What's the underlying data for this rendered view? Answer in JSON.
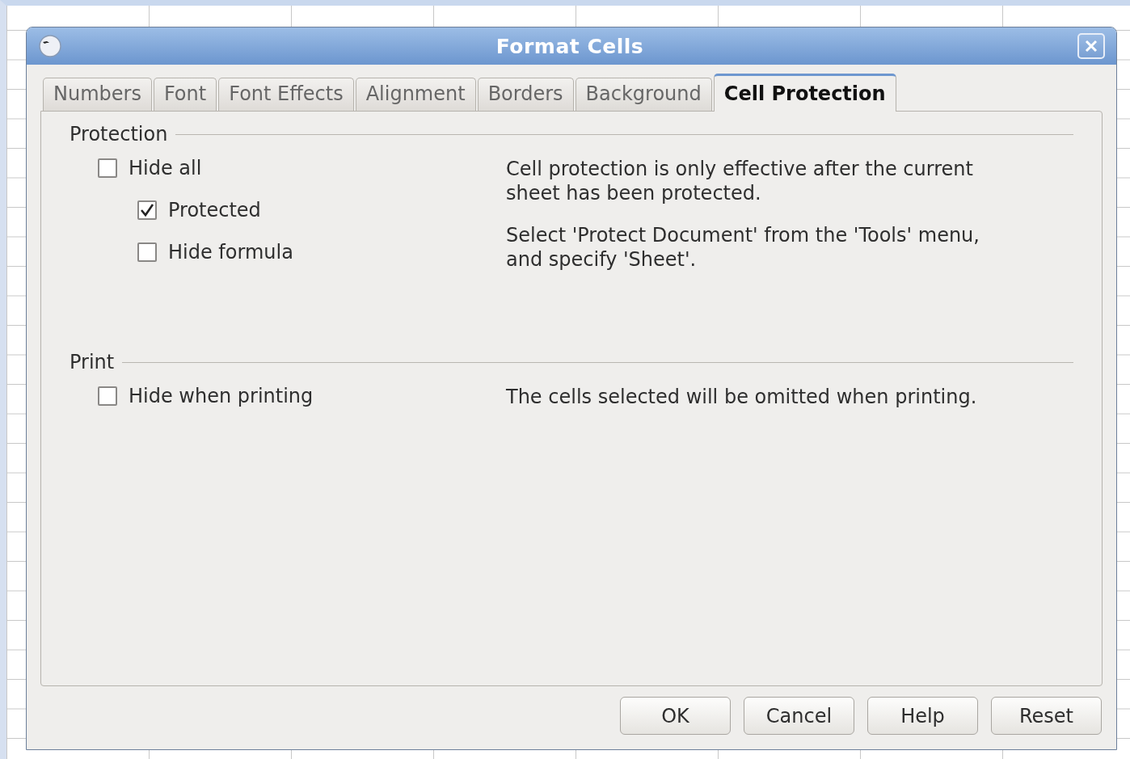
{
  "window": {
    "title": "Format Cells"
  },
  "tabs": [
    {
      "label": "Numbers",
      "selected": false
    },
    {
      "label": "Font",
      "selected": false
    },
    {
      "label": "Font Effects",
      "selected": false
    },
    {
      "label": "Alignment",
      "selected": false
    },
    {
      "label": "Borders",
      "selected": false
    },
    {
      "label": "Background",
      "selected": false
    },
    {
      "label": "Cell Protection",
      "selected": true
    }
  ],
  "sections": [
    {
      "title": "Protection",
      "options": [
        {
          "label": "Hide all",
          "checked": false,
          "children": [
            {
              "label": "Protected",
              "checked": true
            },
            {
              "label": "Hide formula",
              "checked": false
            }
          ]
        }
      ],
      "notes": [
        "Cell protection is only effective after the current sheet has been protected.",
        "Select 'Protect Document' from the 'Tools' menu, and specify 'Sheet'."
      ]
    },
    {
      "title": "Print",
      "options": [
        {
          "label": "Hide when printing",
          "checked": false
        }
      ],
      "notes": [
        "The cells selected will be omitted when printing."
      ]
    }
  ],
  "buttons": [
    {
      "label": "OK"
    },
    {
      "label": "Cancel"
    },
    {
      "label": "Help"
    },
    {
      "label": "Reset"
    }
  ]
}
